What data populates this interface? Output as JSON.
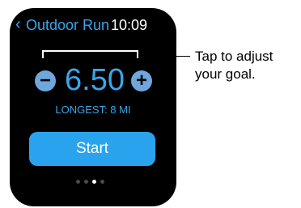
{
  "app": {
    "back_glyph": "‹",
    "title": "Outdoor Run",
    "time": "10:09"
  },
  "goal": {
    "decrement_label": "−",
    "value": "6.50",
    "increment_label": "+",
    "longest_text": "LONGEST: 8 MI"
  },
  "actions": {
    "start_label": "Start"
  },
  "pager": {
    "total_pages": 4,
    "active_page": 3
  },
  "callout": {
    "line1": "Tap to adjust",
    "line2": "your goal."
  },
  "colors": {
    "accent": "#3aa6ea",
    "start_button": "#2aa3ee",
    "stepper_button": "#6fa6dc",
    "watch_background": "#000000"
  }
}
